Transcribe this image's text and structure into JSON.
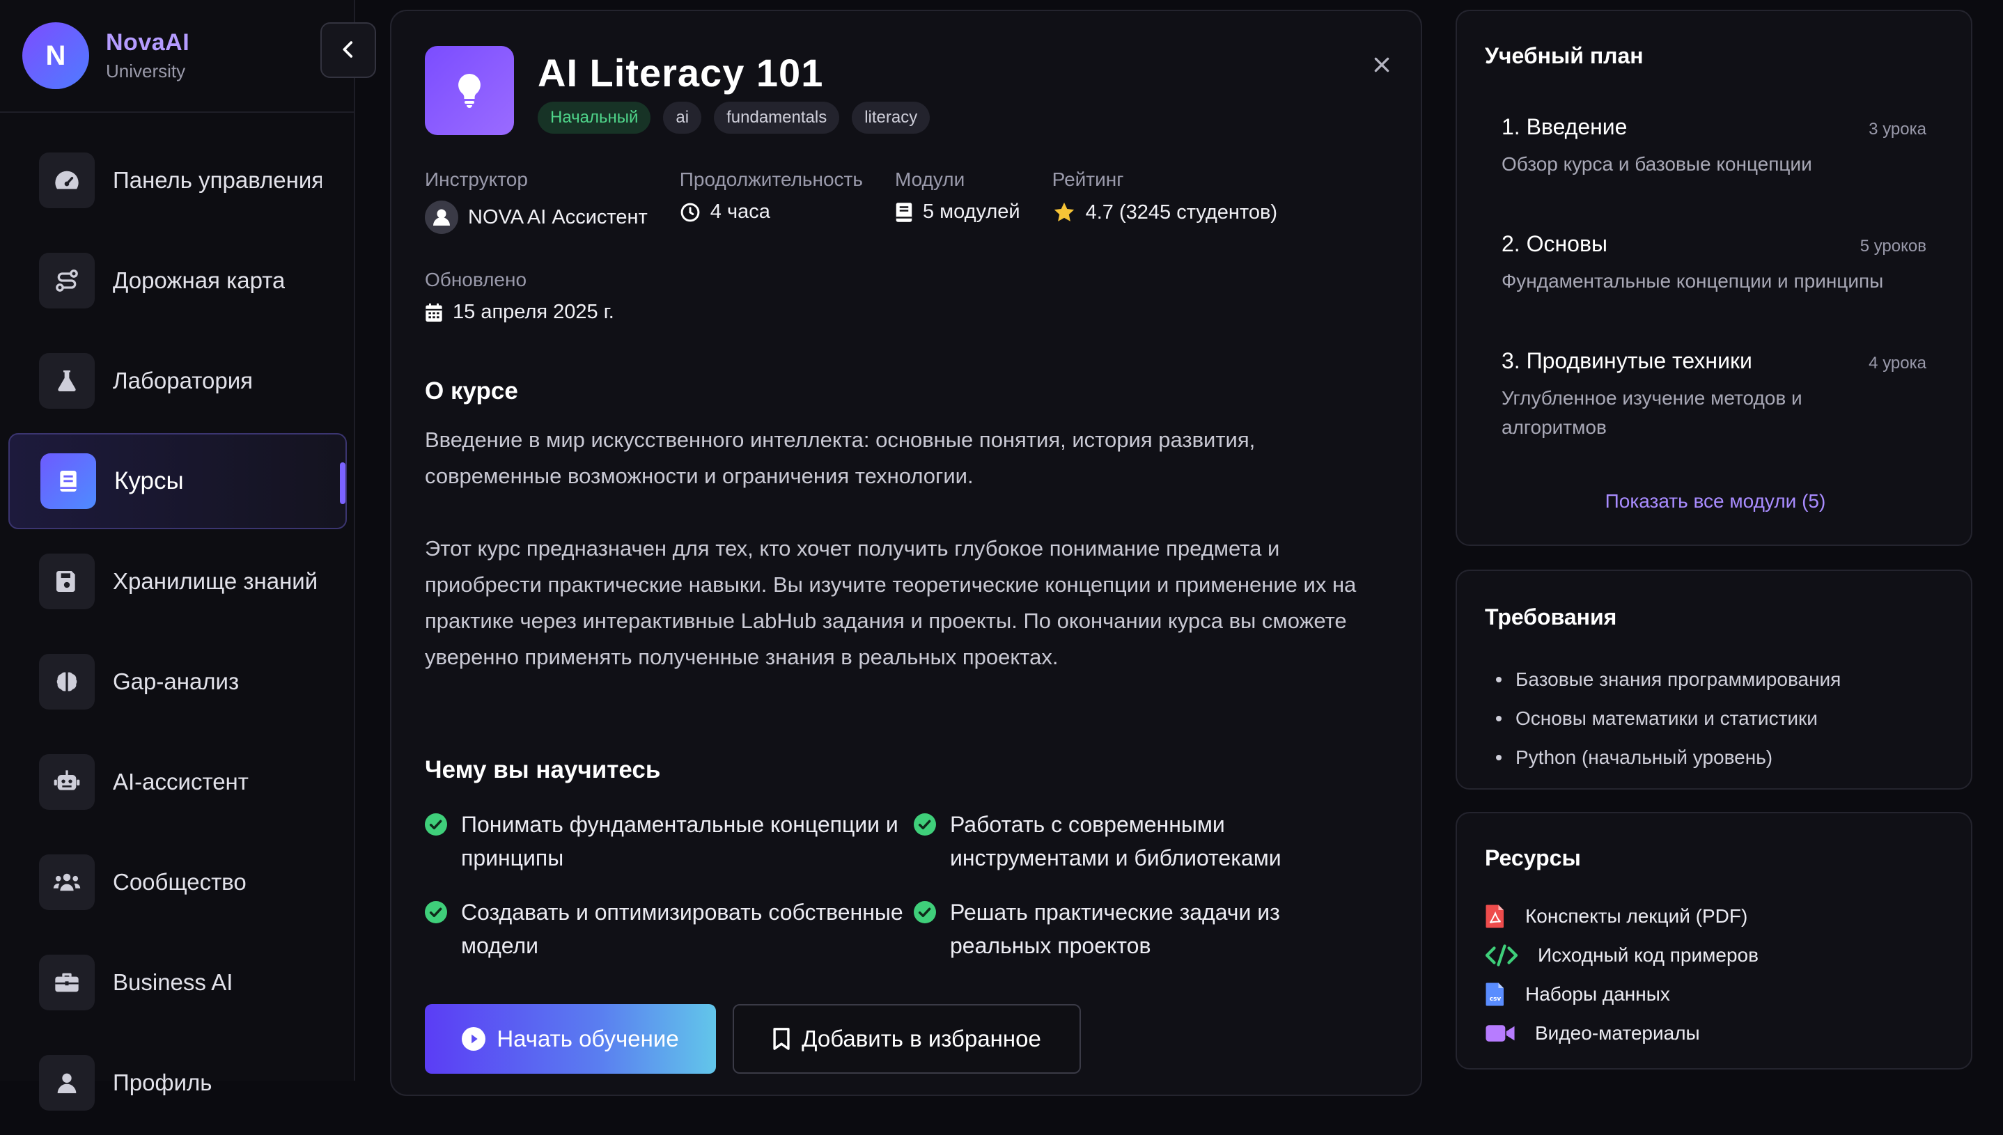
{
  "brand": {
    "initial": "N",
    "name": "NovaAI",
    "subtitle": "University"
  },
  "sidebar": {
    "items": [
      {
        "label": "Панель управления",
        "icon": "gauge-icon"
      },
      {
        "label": "Дорожная карта",
        "icon": "route-icon"
      },
      {
        "label": "Лаборатория",
        "icon": "flask-icon"
      },
      {
        "label": "Курсы",
        "icon": "book-icon",
        "active": true
      },
      {
        "label": "Хранилище знаний",
        "icon": "save-icon"
      },
      {
        "label": "Gap-анализ",
        "icon": "brain-icon"
      },
      {
        "label": "AI-ассистент",
        "icon": "robot-icon"
      },
      {
        "label": "Сообщество",
        "icon": "users-icon"
      },
      {
        "label": "Business AI",
        "icon": "briefcase-icon"
      },
      {
        "label": "Профиль",
        "icon": "user-icon"
      }
    ]
  },
  "course": {
    "title": "AI Literacy 101",
    "level": "Начальный",
    "tags": [
      "ai",
      "fundamentals",
      "literacy"
    ],
    "meta": {
      "instructor_label": "Инструктор",
      "instructor": "NOVA AI Ассистент",
      "duration_label": "Продолжительность",
      "duration": "4 часа",
      "modules_label": "Модули",
      "modules": "5 модулей",
      "rating_label": "Рейтинг",
      "rating": "4.7 (3245 студентов)",
      "updated_label": "Обновлено",
      "updated": "15 апреля 2025 г."
    },
    "about_title": "О курсе",
    "about_p1": "Введение в мир искусственного интеллекта: основные понятия, история развития, современные возможности и ограничения технологии.",
    "about_p2": "Этот курс предназначен для тех, кто хочет получить глубокое понимание предмета и приобрести практические навыки. Вы изучите теоретические концепции и применение их на практике через интерактивные LabHub задания и проекты. По окончании курса вы сможете уверенно применять полученные знания в реальных проектах.",
    "learn_title": "Чему вы научитесь",
    "learn": [
      "Понимать фундаментальные концепции и принципы",
      "Работать с современными инструментами и библиотеками",
      "Создавать и оптимизировать собственные модели",
      "Решать практические задачи из реальных проектов"
    ],
    "start_label": "Начать обучение",
    "favorite_label": "Добавить в избранное"
  },
  "curriculum": {
    "title": "Учебный план",
    "modules": [
      {
        "title": "1. Введение",
        "count": "3 урока",
        "desc": "Обзор курса и базовые концепции"
      },
      {
        "title": "2. Основы",
        "count": "5 уроков",
        "desc": "Фундаментальные концепции и принципы"
      },
      {
        "title": "3. Продвинутые техники",
        "count": "4 урока",
        "desc": "Углубленное изучение методов и алгоритмов"
      }
    ],
    "show_all": "Показать все модули (5)"
  },
  "requirements": {
    "title": "Требования",
    "items": [
      "Базовые знания программирования",
      "Основы математики и статистики",
      "Python (начальный уровень)"
    ]
  },
  "resources": {
    "title": "Ресурсы",
    "items": [
      {
        "label": "Конспекты лекций (PDF)",
        "icon": "pdf-icon"
      },
      {
        "label": "Исходный код примеров",
        "icon": "code-icon"
      },
      {
        "label": "Наборы данных",
        "icon": "csv-icon"
      },
      {
        "label": "Видео-материалы",
        "icon": "video-icon"
      }
    ]
  },
  "colors": {
    "accent": "#7b63ff",
    "success": "#3fcf7a",
    "level_bg": "#173326",
    "level_text": "#4fd58a",
    "link": "#a98cff"
  }
}
